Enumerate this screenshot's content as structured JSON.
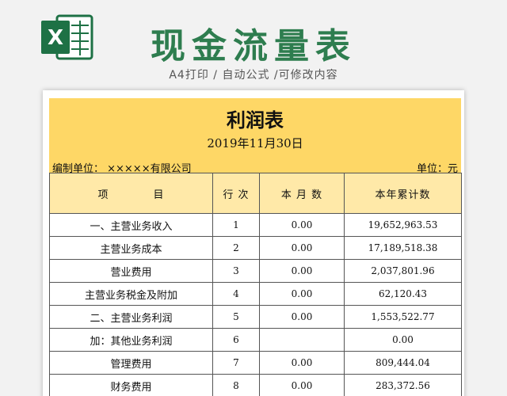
{
  "header": {
    "title": "现金流量表",
    "subtitle": "A4打印 / 自动公式 /可修改内容",
    "logo_letter": "X"
  },
  "report": {
    "title": "利润表",
    "date": "2019年11月30日",
    "compiler": "编制单位： ×××××有限公司",
    "unit": "单位：元"
  },
  "table": {
    "headers": [
      "项　　　　目",
      "行 次",
      "本 月 数",
      "本年累计数"
    ],
    "rows": [
      {
        "item": "一、主营业务收入",
        "line": "1",
        "month": "0.00",
        "ytd": "19,652,963.53"
      },
      {
        "item": "主营业务成本",
        "line": "2",
        "month": "0.00",
        "ytd": "17,189,518.38"
      },
      {
        "item": "营业费用",
        "line": "3",
        "month": "0.00",
        "ytd": "2,037,801.96"
      },
      {
        "item": "主营业务税金及附加",
        "line": "4",
        "month": "0.00",
        "ytd": "62,120.43"
      },
      {
        "item": "二、主营业务利润",
        "line": "5",
        "month": "0.00",
        "ytd": "1,553,522.77"
      },
      {
        "item": "加：其他业务利润",
        "line": "6",
        "month": "",
        "ytd": "0.00"
      },
      {
        "item": "管理费用",
        "line": "7",
        "month": "0.00",
        "ytd": "809,444.04"
      },
      {
        "item": "财务费用",
        "line": "8",
        "month": "0.00",
        "ytd": "283,372.56"
      }
    ]
  },
  "colors": {
    "banner": "#fed766",
    "header_row": "#ffe9a8",
    "title_green": "#2e7d4f",
    "excel_green": "#1e7145"
  }
}
